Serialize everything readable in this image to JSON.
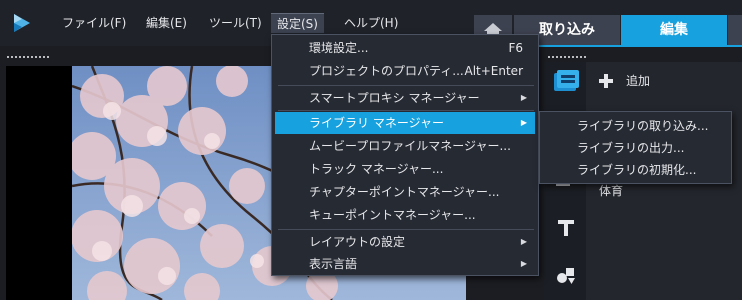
{
  "menubar": {
    "items": [
      {
        "label": "ファイル(F)"
      },
      {
        "label": "編集(E)"
      },
      {
        "label": "ツール(T)"
      },
      {
        "label": "設定(S)"
      },
      {
        "label": "ヘルプ(H)"
      }
    ]
  },
  "tabs": {
    "home_icon": "home-icon",
    "capture": "取り込み",
    "edit": "編集",
    "accent_color": "#17a1de"
  },
  "settings_menu": {
    "items": [
      {
        "label": "環境設定...",
        "shortcut": "F6"
      },
      {
        "label": "プロジェクトのプロパティ...",
        "shortcut": "Alt+Enter"
      },
      {
        "label": "スマートプロキシ マネージャー"
      },
      {
        "label": "ライブラリ マネージャー"
      },
      {
        "label": "ムービープロファイルマネージャー..."
      },
      {
        "label": "トラック マネージャー..."
      },
      {
        "label": "チャプターポイントマネージャー..."
      },
      {
        "label": "キューポイントマネージャー..."
      },
      {
        "label": "レイアウトの設定"
      },
      {
        "label": "表示言語"
      }
    ]
  },
  "library_submenu": {
    "items": [
      {
        "label": "ライブラリの取り込み..."
      },
      {
        "label": "ライブラリの出力..."
      },
      {
        "label": "ライブラリの初期化..."
      }
    ]
  },
  "library": {
    "add_label": "追加",
    "item_label": "体育"
  }
}
